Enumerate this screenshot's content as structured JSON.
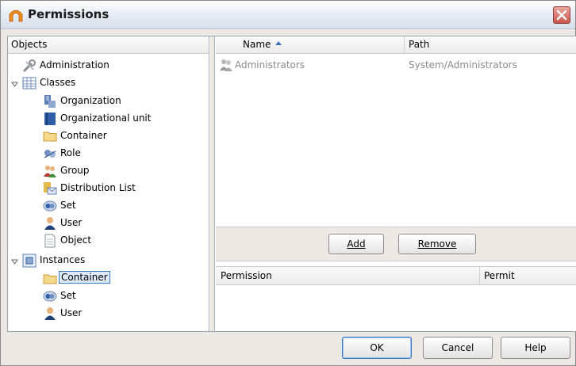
{
  "window": {
    "title": "Permissions"
  },
  "tree": {
    "header": "Objects",
    "items": [
      {
        "label": "Administration",
        "icon": "tools-icon"
      },
      {
        "label": "Classes",
        "icon": "table-icon"
      },
      {
        "label": "Organization",
        "icon": "organization-icon"
      },
      {
        "label": "Organizational unit",
        "icon": "book-icon"
      },
      {
        "label": "Container",
        "icon": "folder-icon"
      },
      {
        "label": "Role",
        "icon": "role-icon"
      },
      {
        "label": "Group",
        "icon": "group-icon"
      },
      {
        "label": "Distribution List",
        "icon": "distribution-list-icon"
      },
      {
        "label": "Set",
        "icon": "set-icon"
      },
      {
        "label": "User",
        "icon": "user-icon"
      },
      {
        "label": "Object",
        "icon": "document-icon"
      },
      {
        "label": "Instances",
        "icon": "instances-icon"
      },
      {
        "label": "Container",
        "icon": "folder-icon"
      },
      {
        "label": "Set",
        "icon": "set-icon"
      },
      {
        "label": "User",
        "icon": "user-icon"
      }
    ]
  },
  "members": {
    "columns": [
      "Name",
      "Path"
    ],
    "rows": [
      {
        "name": "Administrators",
        "path": "System/Administrators",
        "icon": "group-icon"
      }
    ]
  },
  "actions": {
    "add": "Add",
    "remove": "Remove"
  },
  "permissions": {
    "columns": [
      "Permission",
      "Permit"
    ]
  },
  "footer": {
    "ok": "OK",
    "cancel": "Cancel",
    "help": "Help"
  }
}
